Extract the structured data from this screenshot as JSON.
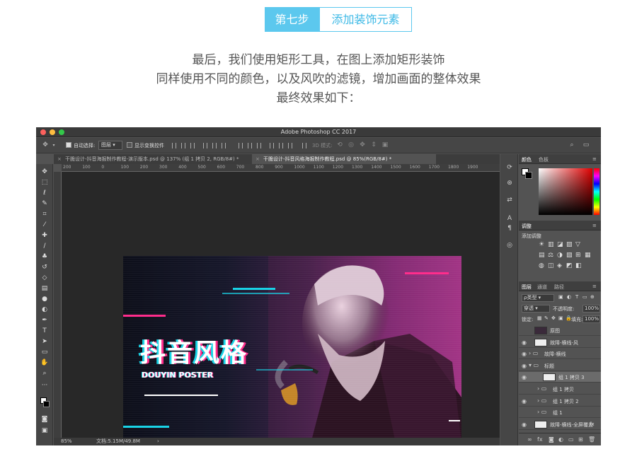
{
  "header": {
    "step_num": "第七步",
    "step_title": "添加装饰元素"
  },
  "intro": [
    "最后，我们使用矩形工具，在图上添加矩形装饰",
    "同样使用不同的颜色，以及风吹的滤镜，增加画面的整体效果",
    "最终效果如下："
  ],
  "app": {
    "title": "Adobe Photoshop CC 2017",
    "options": {
      "auto_select": "自动选择:",
      "auto_select_value": "图层",
      "show_transform": "显示变换控件",
      "mode_3d": "3D 模式:"
    },
    "tabs": [
      {
        "label": "干脆设计-抖音海报制作教程-演示版本.psd @ 137% (组 1 拷贝 2, RGB/8#) *",
        "active": false
      },
      {
        "label": "干脆设计-抖音风格海报制作教程.psd @ 85%(RGB/8#) *",
        "active": true
      }
    ],
    "ruler_ticks": [
      "200",
      "100",
      "0",
      "100",
      "200",
      "300",
      "400",
      "500",
      "600",
      "700",
      "800",
      "900",
      "1000",
      "1100",
      "1200",
      "1300",
      "1400",
      "1500",
      "1600",
      "1700",
      "1800",
      "1900"
    ],
    "status": {
      "zoom": "85%",
      "doc": "文档:5.15M/49.8M"
    },
    "poster": {
      "title": "抖音风格",
      "subtitle": "DOUYIN POSTER"
    },
    "panels": {
      "color_tabs": [
        "颜色",
        "色板"
      ],
      "adjust_tab": "调整",
      "adjust_label": "添加调整",
      "layers_tabs": [
        "图层",
        "通道",
        "路径"
      ],
      "kind_filter": "ρ类型",
      "blend_mode": "穿透",
      "opacity_label": "不透明度:",
      "opacity": "100%",
      "lock_label": "锁定:",
      "fill_label": "填充:",
      "fill": "100%"
    },
    "layers": [
      {
        "name": "原图",
        "type": "image",
        "indent": 0,
        "visible": false
      },
      {
        "name": "故障-横线-风",
        "type": "image",
        "indent": 0,
        "visible": true
      },
      {
        "name": "故障-横线",
        "type": "folder",
        "indent": 0,
        "visible": true
      },
      {
        "name": "标题",
        "type": "folder-open",
        "indent": 0,
        "visible": true
      },
      {
        "name": "组 1 拷贝 3",
        "type": "smart",
        "indent": 1,
        "visible": true,
        "selected": true
      },
      {
        "name": "组 1 拷贝",
        "type": "folder",
        "indent": 1,
        "visible": false
      },
      {
        "name": "组 1 拷贝 2",
        "type": "folder",
        "indent": 1,
        "visible": true
      },
      {
        "name": "组 1",
        "type": "folder",
        "indent": 1,
        "visible": false
      },
      {
        "name": "故障-横线-全屏覆盖",
        "type": "image",
        "indent": 0,
        "visible": true,
        "fx": true
      }
    ],
    "colors": {
      "accent": "#5cc8ee",
      "cyan": "#19d3e6",
      "magenta": "#ff2d8c"
    }
  }
}
